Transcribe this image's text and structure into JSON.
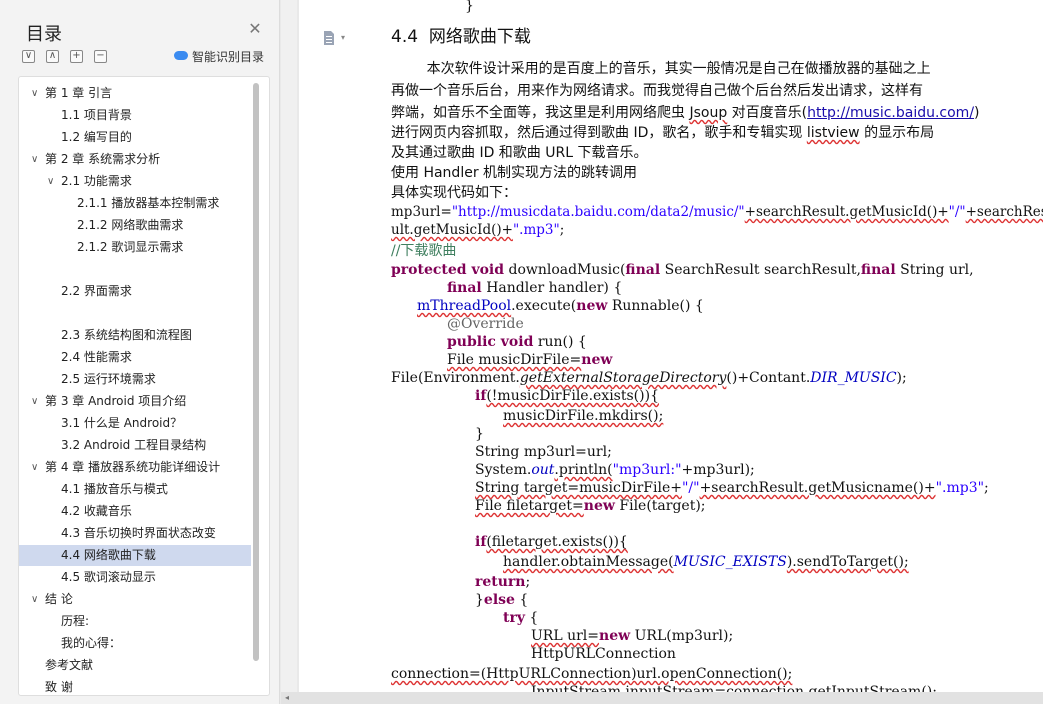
{
  "toc": {
    "title": "目录",
    "smart_label": "智能识别目录",
    "items": [
      {
        "label": "第 1 章  引言",
        "chev": "∨"
      },
      {
        "label": "1.1  项目背景"
      },
      {
        "label": "1.2  编写目的"
      },
      {
        "label": "第 2 章  系统需求分析",
        "chev": "∨"
      },
      {
        "label": "2.1  功能需求",
        "chev": "∨"
      },
      {
        "label": "2.1.1  播放器基本控制需求"
      },
      {
        "label": "2.1.2  网络歌曲需求"
      },
      {
        "label": "2.1.2  歌词显示需求"
      },
      {
        "label": "2.2  界面需求"
      },
      {
        "label": "2.3  系统结构图和流程图"
      },
      {
        "label": "2.4  性能需求"
      },
      {
        "label": "2.5 运行环境需求"
      },
      {
        "label": "第 3 章  Android 项目介绍",
        "chev": "∨"
      },
      {
        "label": "3.1  什么是 Android？"
      },
      {
        "label": "3.2    Android 工程目录结构"
      },
      {
        "label": "第 4 章  播放器系统功能详细设计",
        "chev": "∨"
      },
      {
        "label": "4.1  播放音乐与模式"
      },
      {
        "label": "4.2  收藏音乐"
      },
      {
        "label": "4.3  音乐切换时界面状态改变"
      },
      {
        "label": "4.4  网络歌曲下载"
      },
      {
        "label": "4.5  歌词滚动显示"
      },
      {
        "label": "结    论",
        "chev": "∨"
      },
      {
        "label": "历程:"
      },
      {
        "label": "我的心得："
      },
      {
        "label": "参考文献"
      },
      {
        "label": "致    谢"
      }
    ]
  },
  "doc": {
    "top_brace": "}",
    "heading": "4.4  网络歌曲下载",
    "p1": "        本次软件设计采用的是百度上的音乐，其实一般情况是自己在做播放器的基础之上",
    "p2": "再做一个音乐后台，用来作为网络请求。而我觉得自己做个后台然后发出请求，这样有",
    "p3a": "弊端，如音乐不全面等，我这里是利用网络爬虫 ",
    "p3b": "Jsoup",
    "p3c": " 对百度音乐(",
    "p3link": "http://music.baidu.com/",
    "p3d": ")",
    "p4a": "进行网页内容抓取，然后通过得到歌曲 ID，歌名，歌手和专辑实现 ",
    "p4b": "listview",
    "p4c": " 的显示布局",
    "p5": "及其通过歌曲 ID 和歌曲 URL 下载音乐。",
    "p6": "使用 Handler 机制实现方法的跳转调用",
    "p7": "具体实现代码如下：",
    "c1a": "mp3url=",
    "c1b": "\"http://musicdata.baidu.com/data2/music/\"",
    "c1c": "+searchResult.getMusicId()+",
    "c1d": "\"/\"",
    "c1e": "+searchRes",
    "c2a": "ult.getMusicId()+",
    "c2b": "\".mp3\"",
    "c2c": ";",
    "c3": "//下载歌曲",
    "c4a": "protected void",
    "c4b": " downloadMusic(",
    "c4c": "final",
    "c4d": " SearchResult searchResult,",
    "c4e": "final",
    "c4f": " String url,",
    "c5a": "final",
    "c5b": " Handler handler) {",
    "c6a": "mThreadPool",
    "c6b": ".execute(",
    "c6c": "new",
    "c6d": " Runnable() {",
    "c7": "@Override",
    "c8a": "public void",
    "c8b": " run() {",
    "c9a": "File musicDirFile=",
    "c9b": "new",
    "c10a": "File(Environment.",
    "c10b": "getExternalStorageDirectory",
    "c10c": "()+Contant.",
    "c10d": "DIR_MUSIC",
    "c10e": ");",
    "c11a": "if",
    "c11b": "(!musicDirFile.exists()){",
    "c12": "musicDirFile.mkdirs();",
    "c13": "}",
    "c14": "String mp3url=url;",
    "c15a": "System.",
    "c15b": "out",
    "c15c": ".println(",
    "c15d": "\"mp3url:\"",
    "c15e": "+mp3url);",
    "c16a": "String target=musicDirFile+",
    "c16b": "\"/\"",
    "c16c": "+searchResult.getMusicname()+",
    "c16d": "\".mp3\"",
    "c16e": ";",
    "c17a": "File filetarget=",
    "c17b": "new",
    "c17c": " File(target);",
    "c18a": "if",
    "c18b": "(filetarget.exists()){",
    "c19a": "handler.obtainMessage(",
    "c19b": "MUSIC_EXISTS",
    "c19c": ").sendToTarget();",
    "c20a": "return",
    "c20b": ";",
    "c21a": "}",
    "c21b": "else",
    "c21c": " {",
    "c22a": "try",
    "c22b": " {",
    "c23a": "URL url=",
    "c23b": "new",
    "c23c": " URL(mp3url);",
    "c24": "HttpURLConnection",
    "c25": "connection=(HttpURLConnection)url.openConnection();",
    "c26": "InputStream inputStream=connection.getInputStream();"
  }
}
